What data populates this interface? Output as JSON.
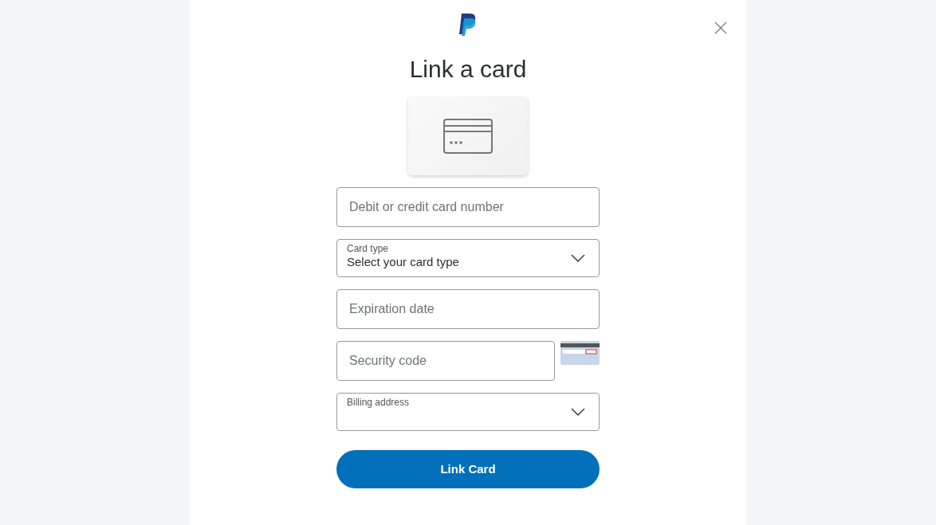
{
  "title": "Link a card",
  "fields": [
    {
      "kind": "text",
      "placeholder": "Debit or credit card number"
    },
    {
      "kind": "select",
      "label": "Card type",
      "value": "Select your card type"
    },
    {
      "kind": "text",
      "placeholder": "Expiration date"
    },
    {
      "kind": "cvv",
      "placeholder": "Security code"
    },
    {
      "kind": "select",
      "label": "Billing address"
    }
  ],
  "button": "Link Card"
}
